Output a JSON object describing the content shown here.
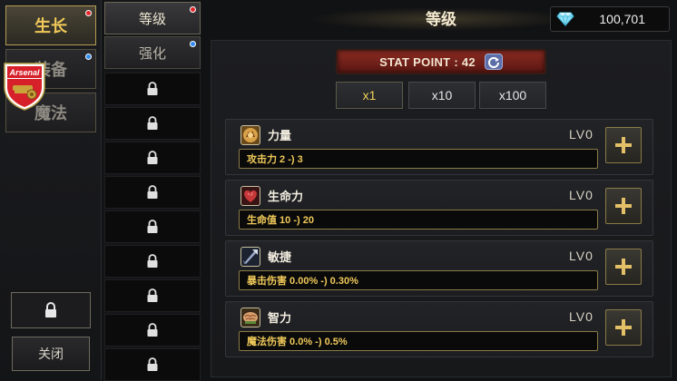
{
  "left_menu": {
    "items": [
      {
        "label": "生长",
        "active": true,
        "badge": "red"
      },
      {
        "label": "装备",
        "active": false,
        "badge": "blue"
      },
      {
        "label": "魔法",
        "active": false,
        "badge": null
      }
    ],
    "crest_text": "Arsenal",
    "close_label": "关闭"
  },
  "sub_menu": {
    "tabs": [
      {
        "label": "等级",
        "active": true,
        "badge": "red"
      },
      {
        "label": "强化",
        "active": false,
        "badge": "blue"
      }
    ],
    "locked_slots": 9
  },
  "header": {
    "title": "等级",
    "gems": "100,701"
  },
  "stat_points": {
    "label": "STAT POINT : 42"
  },
  "multipliers": [
    {
      "label": "x1",
      "active": true
    },
    {
      "label": "x10",
      "active": false
    },
    {
      "label": "x100",
      "active": false
    }
  ],
  "stats": [
    {
      "name": "力量",
      "level": "LV0",
      "effect": "攻击力 2 -) 3",
      "icon": "strength-icon"
    },
    {
      "name": "生命力",
      "level": "LV0",
      "effect": "生命值 10 -) 20",
      "icon": "heart-icon"
    },
    {
      "name": "敏捷",
      "level": "LV0",
      "effect": "暴击伤害 0.00% -) 0.30%",
      "icon": "agility-icon"
    },
    {
      "name": "智力",
      "level": "LV0",
      "effect": "魔法伤害 0.0% -) 0.5%",
      "icon": "brain-icon"
    }
  ],
  "colors": {
    "accent_gold": "#f0c95a",
    "stat_bar_red": "#8a2b22",
    "badge_red": "#e2262a",
    "badge_blue": "#2f8cf0"
  }
}
